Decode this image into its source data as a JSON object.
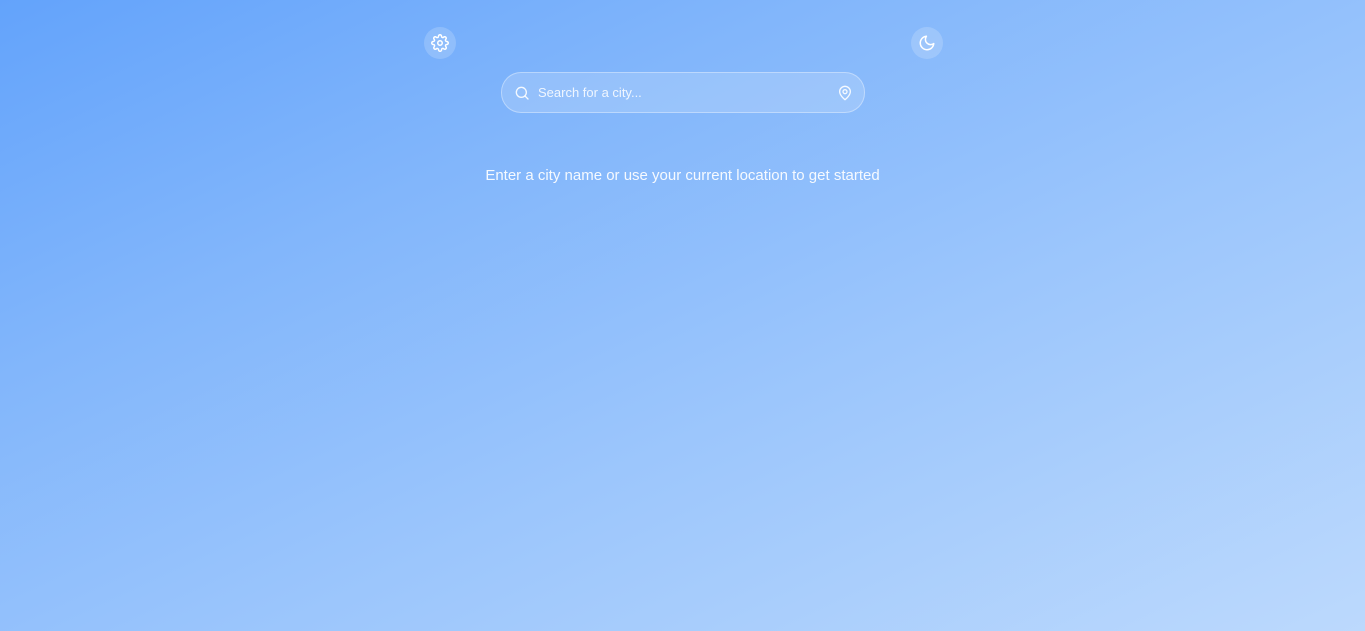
{
  "header": {
    "settings_icon": "gear-icon",
    "theme_icon": "moon-icon"
  },
  "search": {
    "placeholder": "Search for a city...",
    "value": "",
    "search_icon": "search-icon",
    "location_icon": "location-pin-icon"
  },
  "empty_state": {
    "message": "Enter a city name or use your current location to get started"
  },
  "colors": {
    "background_start": "#63a3fb",
    "background_end": "#bcd9fd",
    "text": "#ffffff"
  }
}
